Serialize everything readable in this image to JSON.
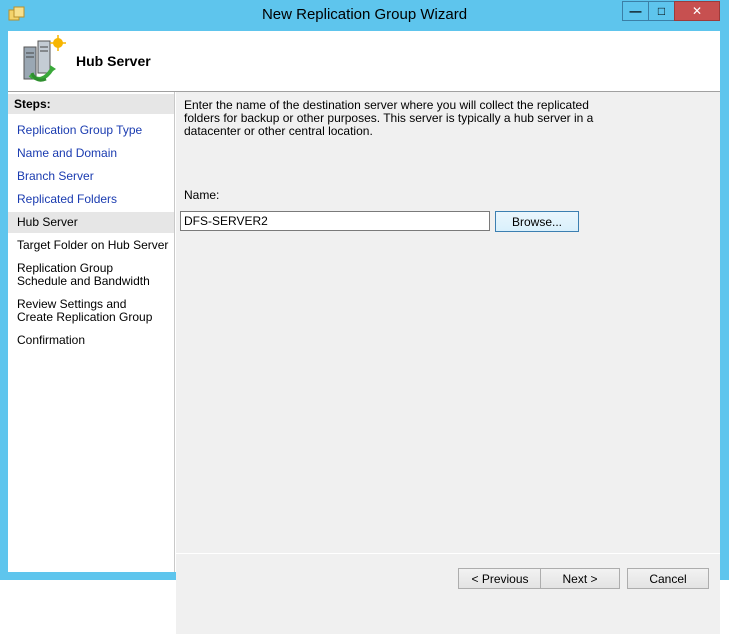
{
  "window": {
    "title": "New Replication Group Wizard",
    "minimize_glyph": "—",
    "maximize_glyph": "□",
    "close_glyph": "✕"
  },
  "header": {
    "title": "Hub Server",
    "icon": "replication-server-icon"
  },
  "steps": {
    "heading": "Steps:",
    "items": [
      {
        "label": "Replication Group Type",
        "state": "link"
      },
      {
        "label": "Name and Domain",
        "state": "link"
      },
      {
        "label": "Branch Server",
        "state": "link"
      },
      {
        "label": "Replicated Folders",
        "state": "link"
      },
      {
        "label": "Hub Server",
        "state": "current"
      },
      {
        "label": "Target Folder on Hub Server",
        "state": "plain"
      },
      {
        "label": "Replication Group Schedule and Bandwidth",
        "state": "plain"
      },
      {
        "label": "Review Settings and Create Replication Group",
        "state": "plain"
      },
      {
        "label": "Confirmation",
        "state": "plain"
      }
    ]
  },
  "content": {
    "description": "Enter the name of the destination server where you will collect the replicated folders for backup or other purposes. This server is typically a hub server in a datacenter or other central location.",
    "name_label": "Name:",
    "name_value": "DFS-SERVER2",
    "browse_label": "Browse..."
  },
  "footer": {
    "previous_label": "< Previous",
    "next_label": "Next >",
    "cancel_label": "Cancel"
  },
  "colors": {
    "frame": "#5ec5ed",
    "link": "#1a3bb0",
    "close_button": "#c75050",
    "content_background": "#f0f0f0"
  }
}
